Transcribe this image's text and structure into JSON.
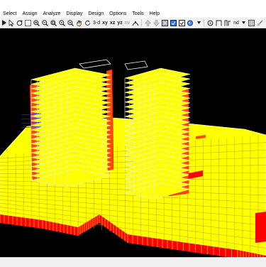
{
  "menu": [
    "Select",
    "Assign",
    "Analyze",
    "Display",
    "Design",
    "Options",
    "Tools",
    "Help"
  ],
  "toolbar": {
    "view_3d": "3-d",
    "view_xy": "xy",
    "view_xz": "xz",
    "view_yz": "yz",
    "view_nv": "nv",
    "nd_label": "nd"
  },
  "colors": {
    "background": "#000000",
    "slab": "#ffff00",
    "core": "#ff4a00",
    "edge": "#ff0000",
    "highlight": "#ffffff",
    "selection": "#1a2cff"
  }
}
